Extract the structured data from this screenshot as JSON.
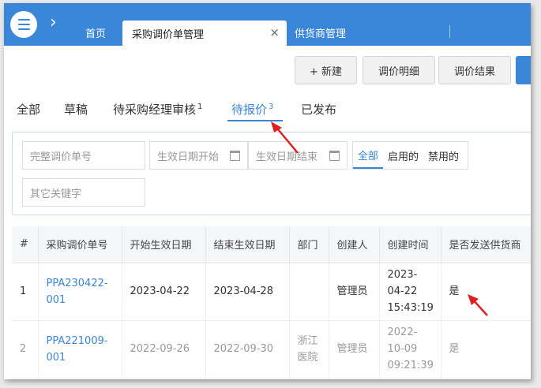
{
  "nav": {
    "home": "首页",
    "active_tab": "采购调价单管理",
    "close_glyph": "×",
    "supplier_tab": "供货商管理",
    "chevron": "›"
  },
  "toolbar": {
    "new_label": "+ 新建",
    "detail_label": "调价明细",
    "result_label": "调价结果"
  },
  "status_tabs": {
    "all": "全部",
    "draft": "草稿",
    "manager_review": "待采购经理审核",
    "manager_review_count": "1",
    "pending_quote": "待报价",
    "pending_quote_count": "3",
    "published": "已发布"
  },
  "filter": {
    "order_no_placeholder": "完整调价单号",
    "start_placeholder": "生效日期开始",
    "end_placeholder": "生效日期结束",
    "keyword_placeholder": "其它关键字",
    "segments": [
      "全部",
      "启用的",
      "禁用的"
    ]
  },
  "table": {
    "headers": [
      "#",
      "采购调价单号",
      "开始生效日期",
      "结束生效日期",
      "部门",
      "创建人",
      "创建时间",
      "是否发送供货商"
    ],
    "rows": [
      {
        "idx": "1",
        "no_line1": "PPA230422-",
        "no_line2": "001",
        "start": "2023-04-22",
        "end": "2023-04-28",
        "dept_line1": "",
        "dept_line2": "",
        "creator": "管理员",
        "time_line1": "2023-",
        "time_line2": "04-22",
        "time_line3": "15:43:19",
        "sent": "是"
      },
      {
        "idx": "2",
        "no_line1": "PPA221009-",
        "no_line2": "001",
        "start": "2022-09-26",
        "end": "2022-09-30",
        "dept_line1": "浙江",
        "dept_line2": "医院",
        "creator": "管理员",
        "time_line1": "2022-",
        "time_line2": "10-09",
        "time_line3": "09:21:39",
        "sent": "是"
      }
    ]
  },
  "colors": {
    "accent": "#3a86d9",
    "annotation": "#e02020"
  }
}
